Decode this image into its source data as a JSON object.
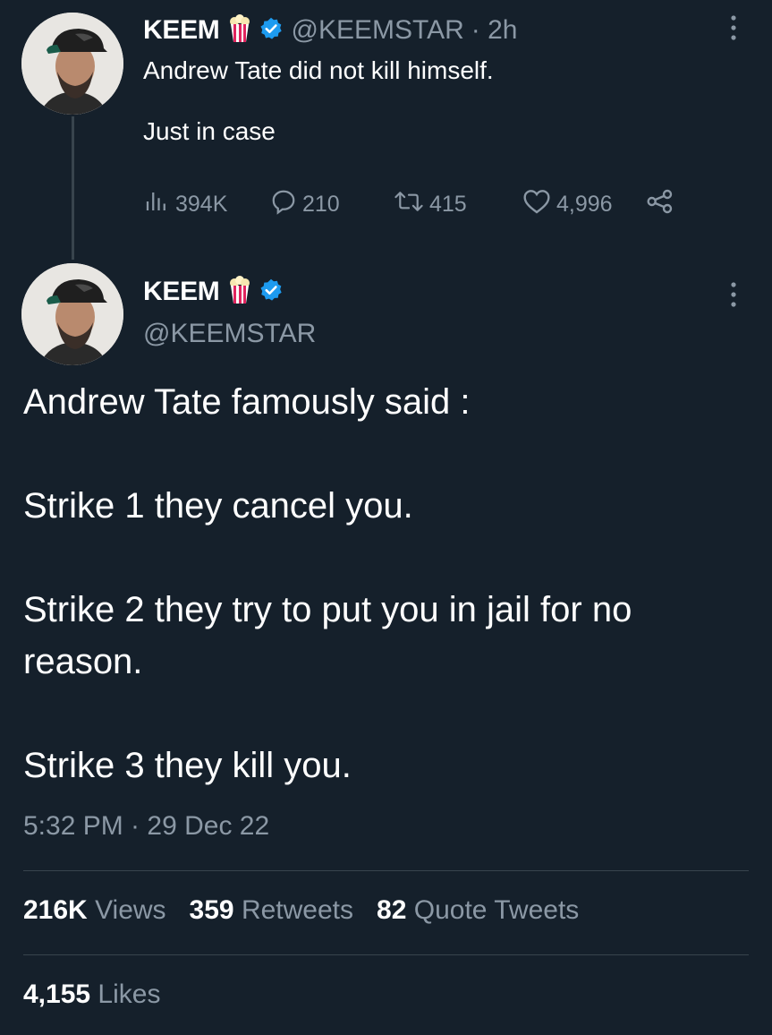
{
  "reply_tweet": {
    "display_name": "KEEM",
    "handle": "@KEEMSTAR",
    "time_ago": "· 2h",
    "text": "Andrew Tate did not kill himself.\n\nJust in case",
    "views": "394K",
    "replies": "210",
    "retweets": "415",
    "likes": "4,996",
    "icons": [
      "popcorn-icon",
      "verified-icon",
      "more-icon",
      "views-icon",
      "reply-icon",
      "retweet-icon",
      "like-icon",
      "share-icon"
    ]
  },
  "main_tweet": {
    "display_name": "KEEM",
    "handle": "@KEEMSTAR",
    "text": "Andrew Tate famously said :\n\nStrike 1 they cancel you.\n\nStrike 2 they try to put you in jail for no reason.\n\nStrike 3 they kill you.",
    "timestamp": "5:32 PM · 29 Dec 22",
    "stats": {
      "views_count": "216K",
      "views_label": "Views",
      "retweets_count": "359",
      "retweets_label": "Retweets",
      "quotes_count": "82",
      "quotes_label": "Quote Tweets",
      "likes_count": "4,155",
      "likes_label": "Likes"
    }
  },
  "colors": {
    "background": "#15202b",
    "text": "#ffffff",
    "muted": "#8b98a5",
    "divider": "#38444d",
    "verified": "#1d9bf0"
  }
}
